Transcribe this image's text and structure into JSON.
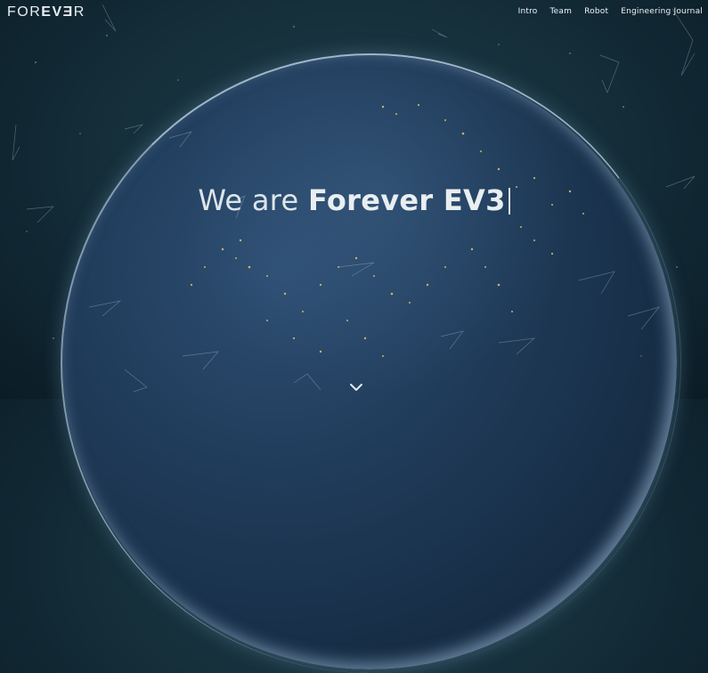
{
  "logo": {
    "part1": "FOR",
    "part2": "EVƎ",
    "part3": "R"
  },
  "nav": [
    {
      "label": "Intro"
    },
    {
      "label": "Team"
    },
    {
      "label": "Robot"
    },
    {
      "label": "Engineering Journal"
    }
  ],
  "hero": {
    "light_text": "We are ",
    "strong_text": "Forever EV3"
  },
  "icons": {
    "scroll": "chevron-down-icon"
  },
  "colors": {
    "background": "#16303b",
    "text": "#e9eef1",
    "city_lights": "#e8c46a"
  }
}
